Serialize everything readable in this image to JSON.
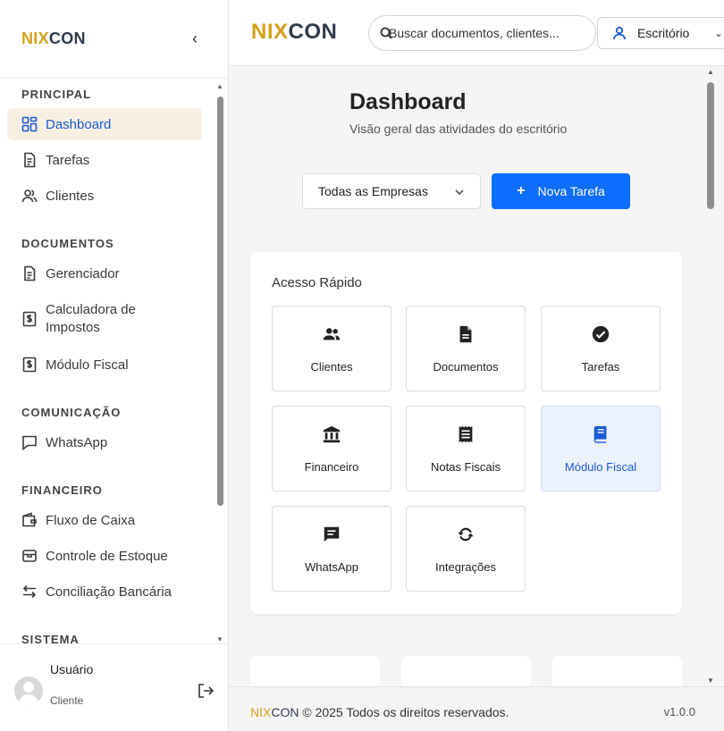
{
  "brand": {
    "part1": "NIX",
    "part2": "CON",
    "color1": "#d4a017",
    "color2": "#2f3b4c"
  },
  "sidebar": {
    "collapse_icon": "chevron-left-icon",
    "sections": [
      {
        "title": "PRINCIPAL",
        "items": [
          {
            "label": "Dashboard",
            "icon": "dashboard-icon",
            "active": true
          },
          {
            "label": "Tarefas",
            "icon": "document-icon"
          },
          {
            "label": "Clientes",
            "icon": "users-icon"
          }
        ]
      },
      {
        "title": "DOCUMENTOS",
        "items": [
          {
            "label": "Gerenciador",
            "icon": "document-icon"
          },
          {
            "label": "Calculadora de Impostos",
            "icon": "dollar-doc-icon"
          },
          {
            "label": "Módulo Fiscal",
            "icon": "dollar-doc-icon"
          }
        ]
      },
      {
        "title": "COMUNICAÇÃO",
        "items": [
          {
            "label": "WhatsApp",
            "icon": "chat-icon"
          }
        ]
      },
      {
        "title": "FINANCEIRO",
        "items": [
          {
            "label": "Fluxo de Caixa",
            "icon": "wallet-icon"
          },
          {
            "label": "Controle de Estoque",
            "icon": "box-icon"
          },
          {
            "label": "Conciliação Bancária",
            "icon": "swap-icon"
          }
        ]
      },
      {
        "title": "SISTEMA",
        "items": []
      }
    ],
    "user": {
      "name": "Usuário",
      "role": "Cliente"
    }
  },
  "topbar": {
    "search_placeholder": "Buscar documentos, clientes...",
    "office_label": "Escritório"
  },
  "main": {
    "title": "Dashboard",
    "subtitle": "Visão geral das atividades do escritório",
    "company_select": "Todas as Empresas",
    "new_task": "Nova Tarefa",
    "quick_access": {
      "title": "Acesso Rápido",
      "tiles": [
        {
          "label": "Clientes",
          "icon": "users-icon"
        },
        {
          "label": "Documentos",
          "icon": "file-icon"
        },
        {
          "label": "Tarefas",
          "icon": "check-circle-icon"
        },
        {
          "label": "Financeiro",
          "icon": "bank-icon"
        },
        {
          "label": "Notas Fiscais",
          "icon": "receipt-icon"
        },
        {
          "label": "Módulo Fiscal",
          "icon": "book-icon",
          "active": true
        },
        {
          "label": "WhatsApp",
          "icon": "message-icon"
        },
        {
          "label": "Integrações",
          "icon": "sync-icon"
        }
      ]
    }
  },
  "footer": {
    "copyright": "© 2025 Todos os direitos reservados.",
    "version": "v1.0.0"
  },
  "colors": {
    "primary": "#0d6efd",
    "active_bg": "#f7f0e2",
    "tile_active_bg": "#ebf2fd"
  }
}
